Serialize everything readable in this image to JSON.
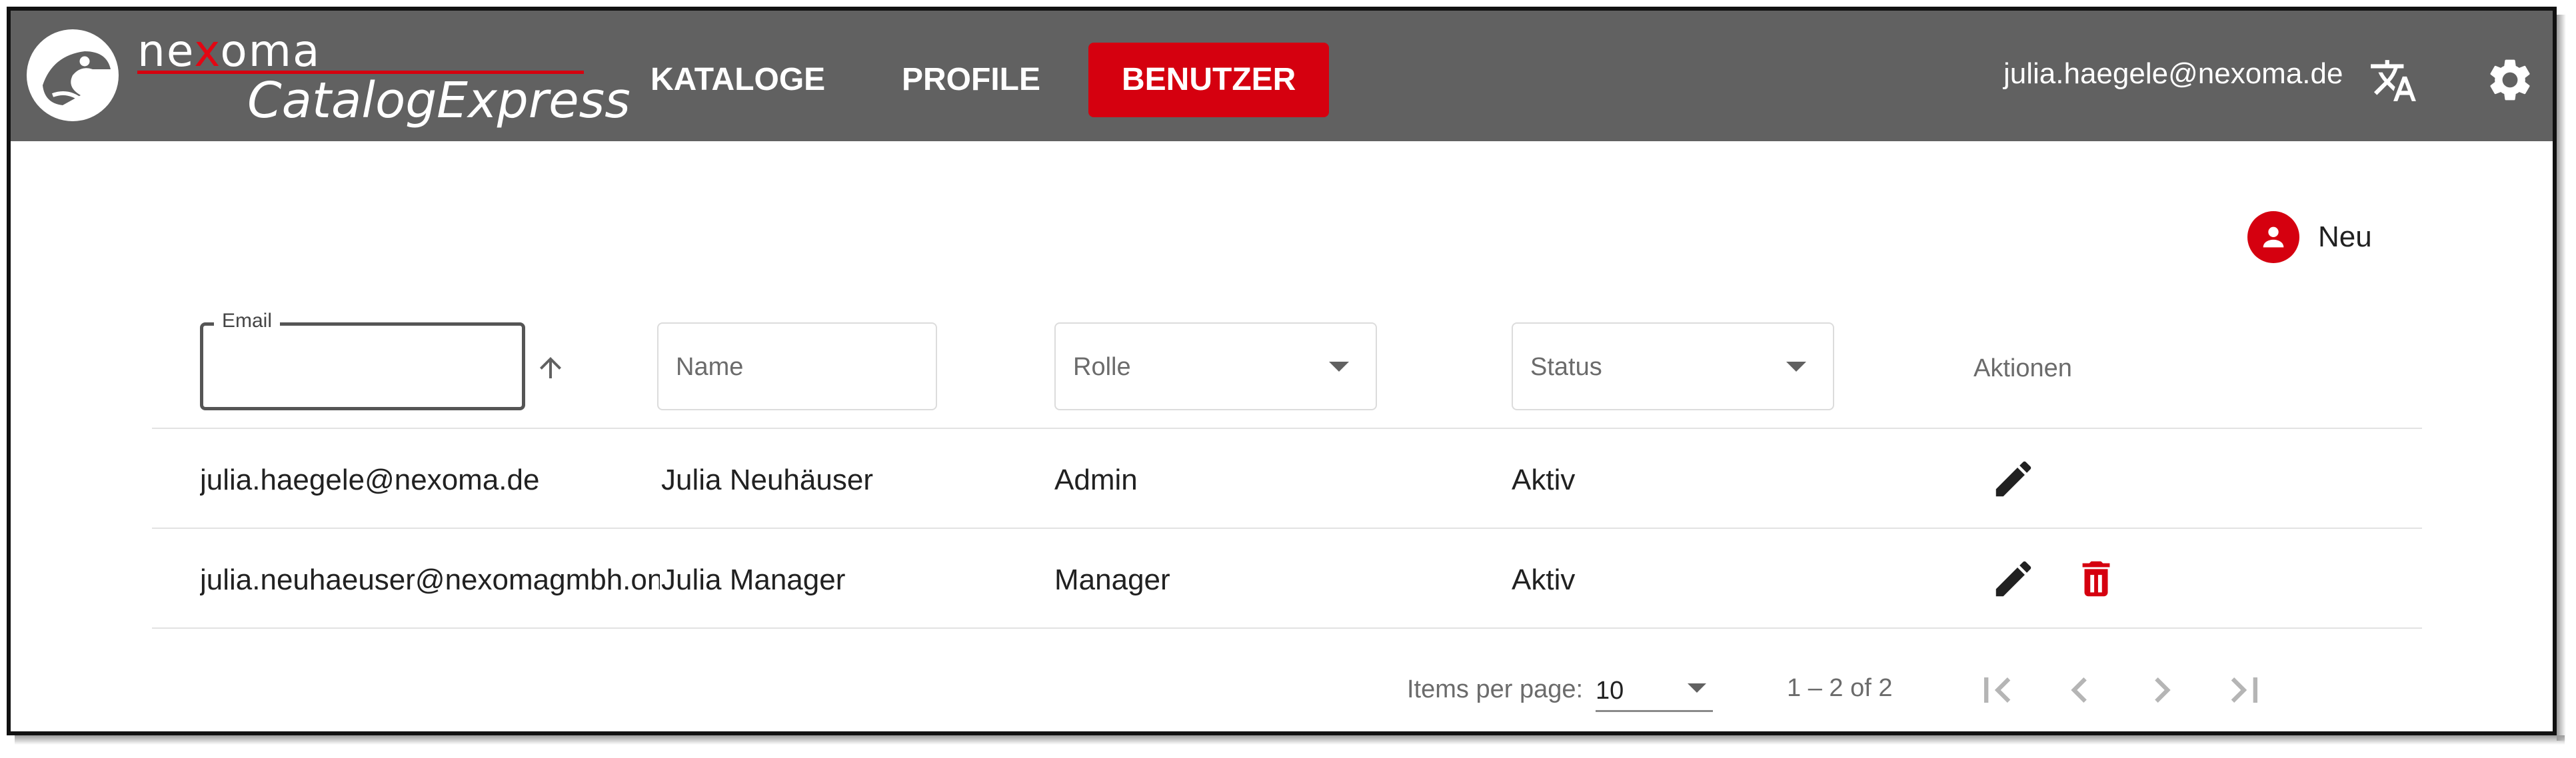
{
  "app": {
    "brand_top": "ne",
    "brand_top_x": "x",
    "brand_top_rest": "oma",
    "brand_bottom": "CatalogExpress"
  },
  "nav": {
    "items": [
      {
        "label": "KATALOGE",
        "active": false
      },
      {
        "label": "PROFILE",
        "active": false
      },
      {
        "label": "BENUTZER",
        "active": true
      }
    ]
  },
  "header": {
    "user_email": "julia.haegele@nexoma.de",
    "translate_icon": "translate-icon",
    "settings_icon": "gear-icon"
  },
  "actions": {
    "new_label": "Neu"
  },
  "filters": {
    "email_label": "Email",
    "email_value": "",
    "name_placeholder": "Name",
    "rolle_placeholder": "Rolle",
    "status_placeholder": "Status",
    "aktionen_label": "Aktionen"
  },
  "table": {
    "rows": [
      {
        "email": "julia.haegele@nexoma.de",
        "name": "Julia Neuhäuser",
        "rolle": "Admin",
        "status": "Aktiv",
        "deletable": false
      },
      {
        "email": "julia.neuhaeuser@nexomagmbh.onmicrosoft.com",
        "name": "Julia Manager",
        "rolle": "Manager",
        "status": "Aktiv",
        "deletable": true
      }
    ]
  },
  "paginator": {
    "items_per_page_label": "Items per page:",
    "page_size": "10",
    "range": "1 – 2 of 2"
  },
  "colors": {
    "accent": "#d5000f",
    "header_bg": "#616161"
  }
}
